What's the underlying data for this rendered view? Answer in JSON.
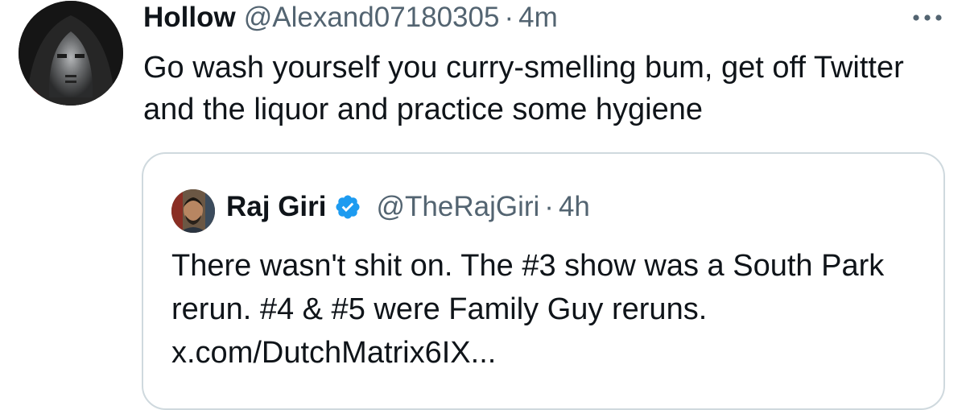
{
  "tweet": {
    "author_name": "Hollow",
    "author_handle": "@Alexand07180305",
    "separator": "·",
    "time": "4m",
    "text": "Go wash yourself you curry-smelling bum, get off Twitter and the liquor and practice some hygiene",
    "more_icon": "ellipsis-icon"
  },
  "quoted_tweet": {
    "author_name": "Raj Giri",
    "verified_icon": "verified-badge-icon",
    "author_handle": "@TheRajGiri",
    "separator": "·",
    "time": "4h",
    "text": "There wasn't shit on. The #3 show was a South Park rerun. #4 & #5 were Family Guy reruns.",
    "link": "x.com/DutchMatrix6IX..."
  },
  "colors": {
    "text_primary": "#0f1419",
    "text_secondary": "#536471",
    "verified_blue": "#1d9bf0",
    "card_border": "#cfd9de"
  }
}
